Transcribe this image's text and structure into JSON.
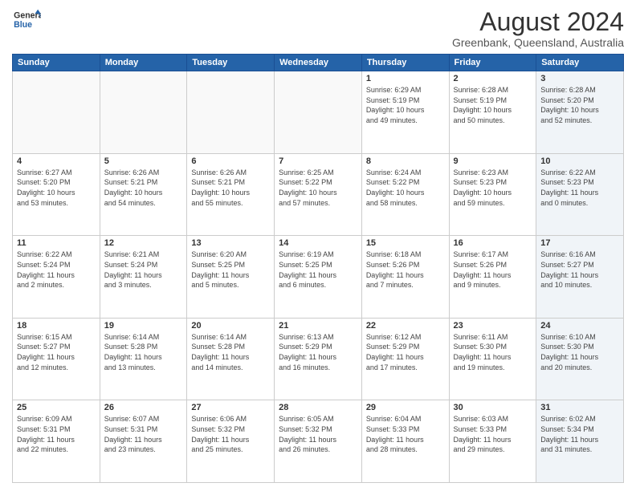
{
  "header": {
    "logo_line1": "General",
    "logo_line2": "Blue",
    "title": "August 2024",
    "subtitle": "Greenbank, Queensland, Australia"
  },
  "weekdays": [
    "Sunday",
    "Monday",
    "Tuesday",
    "Wednesday",
    "Thursday",
    "Friday",
    "Saturday"
  ],
  "weeks": [
    [
      {
        "date": "",
        "info": ""
      },
      {
        "date": "",
        "info": ""
      },
      {
        "date": "",
        "info": ""
      },
      {
        "date": "",
        "info": ""
      },
      {
        "date": "1",
        "info": "Sunrise: 6:29 AM\nSunset: 5:19 PM\nDaylight: 10 hours\nand 49 minutes."
      },
      {
        "date": "2",
        "info": "Sunrise: 6:28 AM\nSunset: 5:19 PM\nDaylight: 10 hours\nand 50 minutes."
      },
      {
        "date": "3",
        "info": "Sunrise: 6:28 AM\nSunset: 5:20 PM\nDaylight: 10 hours\nand 52 minutes."
      }
    ],
    [
      {
        "date": "4",
        "info": "Sunrise: 6:27 AM\nSunset: 5:20 PM\nDaylight: 10 hours\nand 53 minutes."
      },
      {
        "date": "5",
        "info": "Sunrise: 6:26 AM\nSunset: 5:21 PM\nDaylight: 10 hours\nand 54 minutes."
      },
      {
        "date": "6",
        "info": "Sunrise: 6:26 AM\nSunset: 5:21 PM\nDaylight: 10 hours\nand 55 minutes."
      },
      {
        "date": "7",
        "info": "Sunrise: 6:25 AM\nSunset: 5:22 PM\nDaylight: 10 hours\nand 57 minutes."
      },
      {
        "date": "8",
        "info": "Sunrise: 6:24 AM\nSunset: 5:22 PM\nDaylight: 10 hours\nand 58 minutes."
      },
      {
        "date": "9",
        "info": "Sunrise: 6:23 AM\nSunset: 5:23 PM\nDaylight: 10 hours\nand 59 minutes."
      },
      {
        "date": "10",
        "info": "Sunrise: 6:22 AM\nSunset: 5:23 PM\nDaylight: 11 hours\nand 0 minutes."
      }
    ],
    [
      {
        "date": "11",
        "info": "Sunrise: 6:22 AM\nSunset: 5:24 PM\nDaylight: 11 hours\nand 2 minutes."
      },
      {
        "date": "12",
        "info": "Sunrise: 6:21 AM\nSunset: 5:24 PM\nDaylight: 11 hours\nand 3 minutes."
      },
      {
        "date": "13",
        "info": "Sunrise: 6:20 AM\nSunset: 5:25 PM\nDaylight: 11 hours\nand 5 minutes."
      },
      {
        "date": "14",
        "info": "Sunrise: 6:19 AM\nSunset: 5:25 PM\nDaylight: 11 hours\nand 6 minutes."
      },
      {
        "date": "15",
        "info": "Sunrise: 6:18 AM\nSunset: 5:26 PM\nDaylight: 11 hours\nand 7 minutes."
      },
      {
        "date": "16",
        "info": "Sunrise: 6:17 AM\nSunset: 5:26 PM\nDaylight: 11 hours\nand 9 minutes."
      },
      {
        "date": "17",
        "info": "Sunrise: 6:16 AM\nSunset: 5:27 PM\nDaylight: 11 hours\nand 10 minutes."
      }
    ],
    [
      {
        "date": "18",
        "info": "Sunrise: 6:15 AM\nSunset: 5:27 PM\nDaylight: 11 hours\nand 12 minutes."
      },
      {
        "date": "19",
        "info": "Sunrise: 6:14 AM\nSunset: 5:28 PM\nDaylight: 11 hours\nand 13 minutes."
      },
      {
        "date": "20",
        "info": "Sunrise: 6:14 AM\nSunset: 5:28 PM\nDaylight: 11 hours\nand 14 minutes."
      },
      {
        "date": "21",
        "info": "Sunrise: 6:13 AM\nSunset: 5:29 PM\nDaylight: 11 hours\nand 16 minutes."
      },
      {
        "date": "22",
        "info": "Sunrise: 6:12 AM\nSunset: 5:29 PM\nDaylight: 11 hours\nand 17 minutes."
      },
      {
        "date": "23",
        "info": "Sunrise: 6:11 AM\nSunset: 5:30 PM\nDaylight: 11 hours\nand 19 minutes."
      },
      {
        "date": "24",
        "info": "Sunrise: 6:10 AM\nSunset: 5:30 PM\nDaylight: 11 hours\nand 20 minutes."
      }
    ],
    [
      {
        "date": "25",
        "info": "Sunrise: 6:09 AM\nSunset: 5:31 PM\nDaylight: 11 hours\nand 22 minutes."
      },
      {
        "date": "26",
        "info": "Sunrise: 6:07 AM\nSunset: 5:31 PM\nDaylight: 11 hours\nand 23 minutes."
      },
      {
        "date": "27",
        "info": "Sunrise: 6:06 AM\nSunset: 5:32 PM\nDaylight: 11 hours\nand 25 minutes."
      },
      {
        "date": "28",
        "info": "Sunrise: 6:05 AM\nSunset: 5:32 PM\nDaylight: 11 hours\nand 26 minutes."
      },
      {
        "date": "29",
        "info": "Sunrise: 6:04 AM\nSunset: 5:33 PM\nDaylight: 11 hours\nand 28 minutes."
      },
      {
        "date": "30",
        "info": "Sunrise: 6:03 AM\nSunset: 5:33 PM\nDaylight: 11 hours\nand 29 minutes."
      },
      {
        "date": "31",
        "info": "Sunrise: 6:02 AM\nSunset: 5:34 PM\nDaylight: 11 hours\nand 31 minutes."
      }
    ]
  ]
}
